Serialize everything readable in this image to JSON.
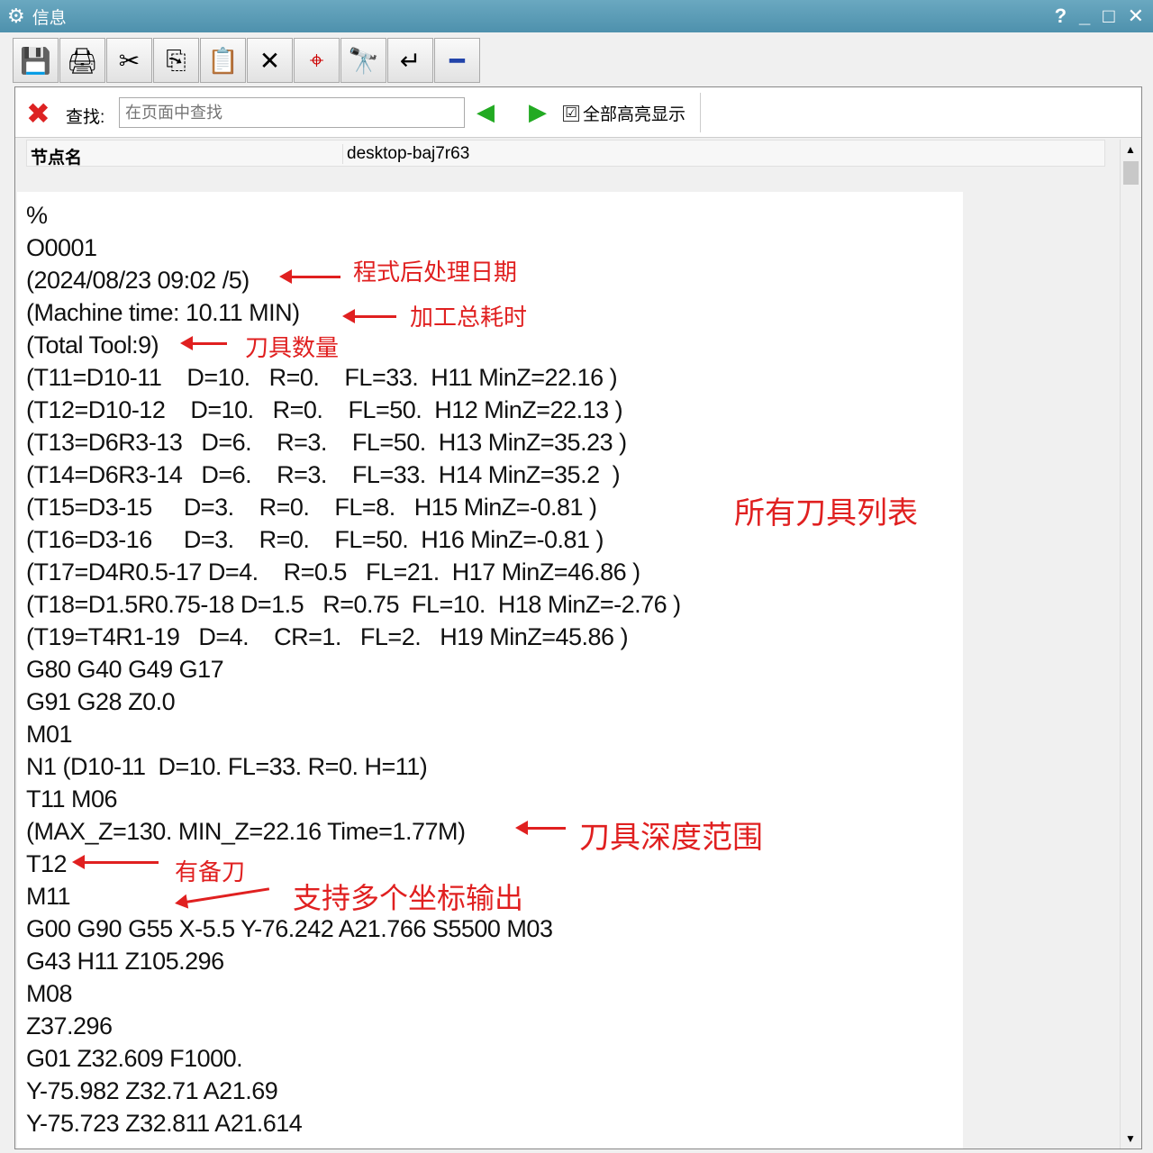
{
  "window": {
    "title": "信息",
    "controls": [
      "?",
      "_",
      "□",
      "✕"
    ]
  },
  "toolbar": [
    {
      "name": "save-icon",
      "glyph": "💾"
    },
    {
      "name": "print-icon",
      "glyph": "🖨"
    },
    {
      "name": "cut-icon",
      "glyph": "✂"
    },
    {
      "name": "copy-icon",
      "glyph": "⎘"
    },
    {
      "name": "paste-icon",
      "glyph": "📋"
    },
    {
      "name": "delete-icon",
      "glyph": "✕"
    },
    {
      "name": "target-icon",
      "glyph": "⌖"
    },
    {
      "name": "binoculars-icon",
      "glyph": "🔭"
    },
    {
      "name": "wrap-icon",
      "glyph": "↵"
    },
    {
      "name": "minimize-icon",
      "glyph": "━"
    }
  ],
  "find": {
    "close": "✖",
    "label": "查找:",
    "placeholder": "在页面中查找",
    "prev": "◀",
    "next": "▶",
    "highlight_all": "全部高亮显示",
    "checked": "☑"
  },
  "node": {
    "key": "节点名",
    "value": "desktop-baj7r63"
  },
  "lines": [
    "%",
    "O0001",
    "(2024/08/23 09:02 /5)",
    "(Machine time: 10.11 MIN)",
    "(Total Tool:9)",
    "(T11=D10-11    D=10.   R=0.    FL=33.  H11 MinZ=22.16 )",
    "(T12=D10-12    D=10.   R=0.    FL=50.  H12 MinZ=22.13 )",
    "(T13=D6R3-13   D=6.    R=3.    FL=50.  H13 MinZ=35.23 )",
    "(T14=D6R3-14   D=6.    R=3.    FL=33.  H14 MinZ=35.2  )",
    "(T15=D3-15     D=3.    R=0.    FL=8.   H15 MinZ=-0.81 )",
    "(T16=D3-16     D=3.    R=0.    FL=50.  H16 MinZ=-0.81 )",
    "(T17=D4R0.5-17 D=4.    R=0.5   FL=21.  H17 MinZ=46.86 )",
    "(T18=D1.5R0.75-18 D=1.5   R=0.75  FL=10.  H18 MinZ=-2.76 )",
    "(T19=T4R1-19   D=4.    CR=1.   FL=2.   H19 MinZ=45.86 )",
    "G80 G40 G49 G17",
    "G91 G28 Z0.0",
    "M01",
    "N1 (D10-11  D=10. FL=33. R=0. H=11)",
    "T11 M06",
    "(MAX_Z=130. MIN_Z=22.16 Time=1.77M)",
    "T12",
    "M11",
    "G00 G90 G55 X-5.5 Y-76.242 A21.766 S5500 M03",
    "G43 H11 Z105.296",
    "M08",
    "Z37.296",
    "G01 Z32.609 F1000.",
    "Y-75.982 Z32.71 A21.69",
    "Y-75.723 Z32.811 A21.614"
  ],
  "annotations": {
    "post_date": "程式后处理日期",
    "total_time": "加工总耗时",
    "tool_count": "刀具数量",
    "tool_list": "所有刀具列表",
    "depth_range": "刀具深度范围",
    "spare_tool": "有备刀",
    "multi_coord": "支持多个坐标输出"
  },
  "scrollbar": {
    "up": "▲",
    "down": "▼"
  }
}
